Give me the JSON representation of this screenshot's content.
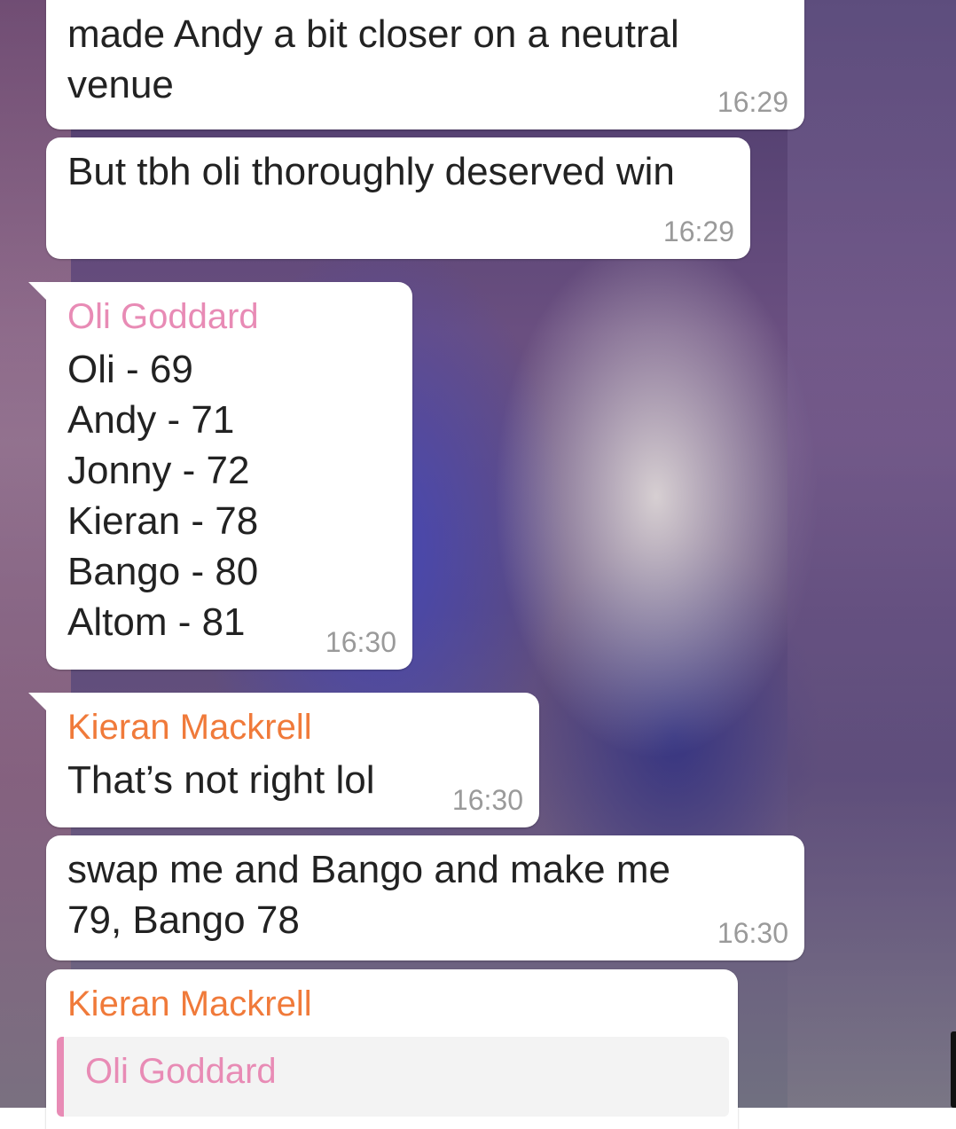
{
  "messages": [
    {
      "text": "made Andy a bit closer on a neutral\nvenue",
      "time": "16:29"
    },
    {
      "text": "But tbh oli thoroughly deserved win",
      "time": "16:29"
    },
    {
      "sender": "Oli Goddard",
      "text": "Oli - 69\nAndy - 71\nJonny - 72\nKieran - 78\nBango - 80\nAltom - 81",
      "time": "16:30"
    },
    {
      "sender": "Kieran Mackrell",
      "text": "That’s not right lol",
      "time": "16:30"
    },
    {
      "text": "swap me and Bango and make me\n79, Bango 78",
      "time": "16:30"
    },
    {
      "sender": "Kieran Mackrell",
      "quote_sender": "Oli Goddard"
    }
  ],
  "colors": {
    "sender_oli": "#e88bb5",
    "sender_kieran": "#f07a3a",
    "bubble": "#ffffff",
    "timestamp": "#9a9a9a"
  }
}
